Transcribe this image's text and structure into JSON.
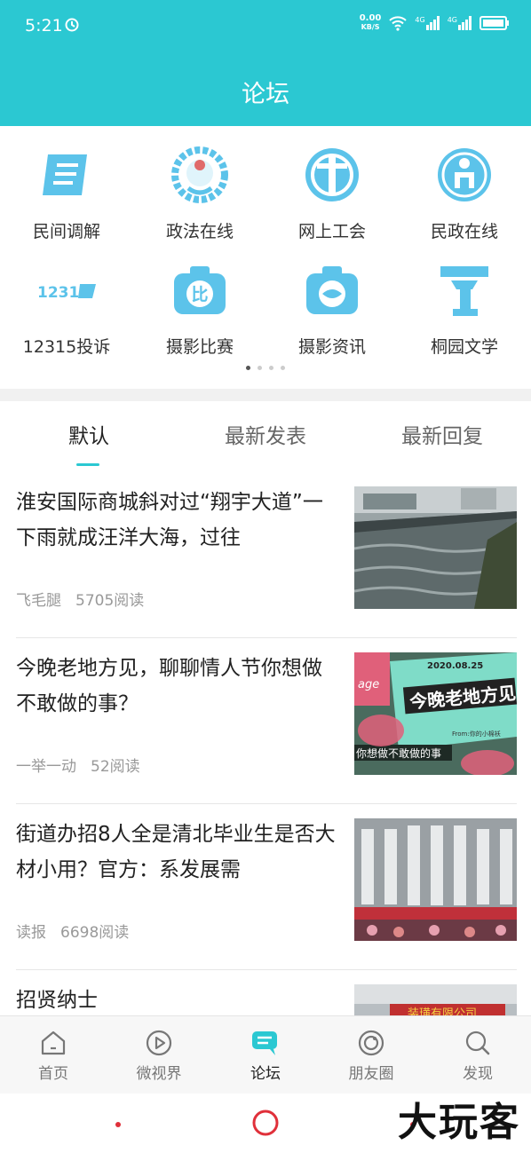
{
  "status": {
    "time": "5:21",
    "net_speed": "0.00",
    "net_unit": "KB/S",
    "signal1": "4G",
    "signal2": "4G"
  },
  "header": {
    "title": "论坛"
  },
  "shortcuts": [
    {
      "label": "民间调解",
      "icon": "scroll-icon"
    },
    {
      "label": "政法在线",
      "icon": "emblem-icon"
    },
    {
      "label": "网上工会",
      "icon": "union-icon"
    },
    {
      "label": "民政在线",
      "icon": "civil-affairs-icon"
    },
    {
      "label": "12315投诉",
      "icon": "complaint-12315-icon"
    },
    {
      "label": "摄影比赛",
      "icon": "camera-contest-icon"
    },
    {
      "label": "摄影资讯",
      "icon": "camera-news-icon"
    },
    {
      "label": "桐园文学",
      "icon": "literature-icon"
    }
  ],
  "pager": {
    "pages": 4,
    "current": 1
  },
  "tabs": {
    "default": "默认",
    "latest_post": "最新发表",
    "latest_reply": "最新回复"
  },
  "posts": [
    {
      "title": "淮安国际商城斜对过“翔宇大道”一下雨就成汪洋大海，过往",
      "author": "飞毛腿",
      "reads": "5705阅读"
    },
    {
      "title": "今晚老地方见，聊聊情人节你想做不敢做的事？",
      "author": "一举一动",
      "reads": "52阅读",
      "thumb_text": {
        "date": "2020.08.25",
        "headline": "今晚老地方见",
        "sub": "你想做不敢做的事",
        "from": "From:你的小棉袄",
        "tag": "age"
      }
    },
    {
      "title": "街道办招8人全是清北毕业生是否大材小用？官方：系发展需",
      "author": "读报",
      "reads": "6698阅读"
    },
    {
      "title": "招贤纳士",
      "thumb_text": {
        "sign": "装璜有限公司"
      }
    }
  ],
  "bottom_nav": {
    "home": "首页",
    "video": "微视界",
    "forum": "论坛",
    "moments": "朋友圈",
    "discover": "发现"
  },
  "watermark": "大玩客",
  "colors": {
    "accent": "#2bc8d2",
    "icon_blue": "#5cc3ea"
  }
}
